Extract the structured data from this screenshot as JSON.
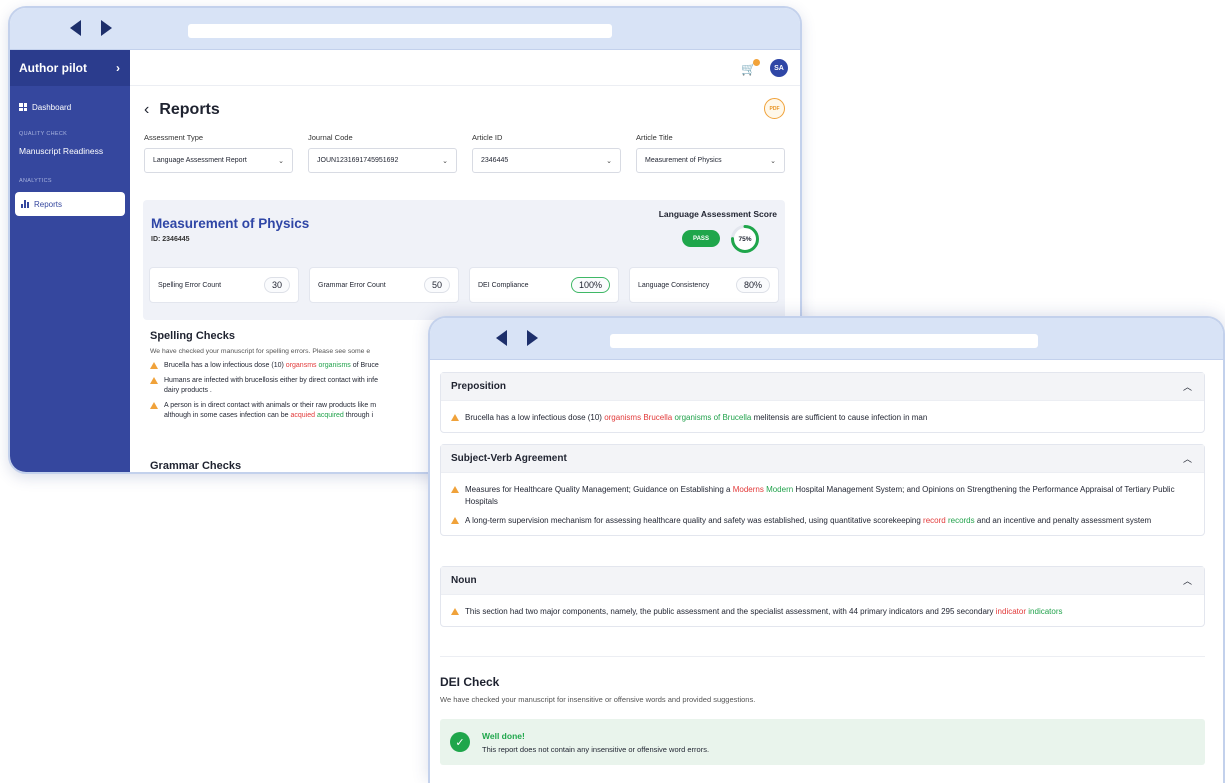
{
  "sidebar": {
    "brand": "Author pilot",
    "dashboard": "Dashboard",
    "section_quality": "QUALITY CHECK",
    "manuscript": "Manuscript Readiness",
    "section_analytics": "ANALYTICS",
    "reports": "Reports"
  },
  "header": {
    "avatar": "SA"
  },
  "page": {
    "title": "Reports",
    "pdf_label": "PDF"
  },
  "filters": [
    {
      "label": "Assessment Type",
      "value": "Language Assessment Report"
    },
    {
      "label": "Journal Code",
      "value": "JOUN1231691745951692"
    },
    {
      "label": "Article ID",
      "value": "2346445"
    },
    {
      "label": "Article Title",
      "value": "Measurement of Physics"
    }
  ],
  "summary": {
    "title": "Measurement of Physics",
    "id": "ID: 2346445",
    "score_label": "Language Assessment Score",
    "status": "PASS",
    "score": "75%",
    "score_fraction": 0.75,
    "metrics": [
      {
        "label": "Spelling Error Count",
        "value": "30"
      },
      {
        "label": "Grammar Error Count",
        "value": "50"
      },
      {
        "label": "DEI Compliance",
        "value": "100%"
      },
      {
        "label": "Language Consistency",
        "value": "80%"
      }
    ]
  },
  "spelling": {
    "title": "Spelling Checks",
    "desc": "We have checked your manuscript for spelling errors. Please see some e",
    "items": [
      {
        "pre": "Brucella has a low infectious dose (10) ",
        "wrong": "organsms",
        "right": "organisms",
        "post": " of Bruce"
      },
      {
        "pre": "Humans are infected with brucellosis either by direct contact with infe",
        "line2": "dairy products ."
      },
      {
        "pre": "A person is in direct contact with animals or their raw products like m",
        "line2_pre": "although in some cases infection can be ",
        "wrong": "acquied",
        "right": "acquired",
        "post": " through i"
      }
    ]
  },
  "grammar": {
    "title": "Grammar Checks"
  },
  "panels": [
    {
      "title": "Preposition",
      "items": [
        {
          "pre": "Brucella has a low infectious dose (10) ",
          "wrong": "organisms Brucella",
          "right": "organisms of Brucella",
          "post": " melitensis are sufficient to cause infection in man"
        }
      ]
    },
    {
      "title": "Subject-Verb Agreement",
      "items": [
        {
          "pre": "Measures for Healthcare Quality Management; Guidance on Establishing a ",
          "wrong": "Moderns",
          "right": "Modern",
          "post": " Hospital Management System; and Opinions on Strengthening the Performance Appraisal of Tertiary Public Hospitals"
        },
        {
          "pre": "A long-term supervision mechanism for assessing healthcare quality and safety was established, using quantitative scorekeeping ",
          "wrong": "record",
          "right": "records",
          "post": " and an incentive and penalty assessment system"
        }
      ]
    },
    {
      "title": "Noun",
      "items": [
        {
          "pre": "This section had two major components, namely, the public assessment and the specialist assessment, with 44 primary indicators and 295 secondary ",
          "wrong": "indicator",
          "right": "indicators",
          "post": ""
        }
      ]
    }
  ],
  "dei": {
    "title": "DEI Check",
    "desc": "We have checked your manuscript for insensitive or offensive words and provided suggestions.",
    "success_title": "Well done!",
    "success_desc": "This report does not contain any insensitive or offensive word errors."
  },
  "colors": {
    "primary": "#35479e",
    "success": "#1fa64b",
    "error": "#e23a3a",
    "warning": "#f0a23a"
  }
}
